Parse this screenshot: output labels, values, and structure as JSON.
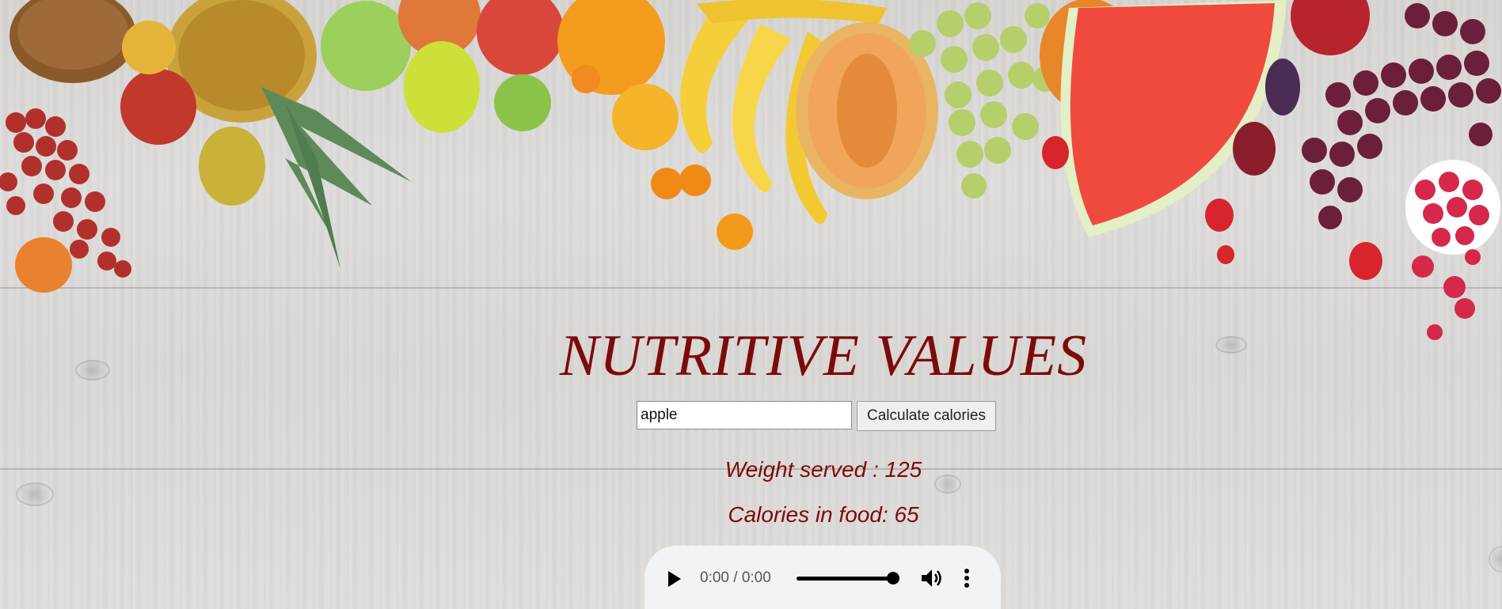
{
  "page": {
    "title": "NUTRITIVE VALUES"
  },
  "search": {
    "value": "apple",
    "button_label": "Calculate calories"
  },
  "results": {
    "weight_text": "Weight served : 125",
    "calories_text": "Calories in food: 65"
  },
  "audio": {
    "time": "0:00 / 0:00",
    "play_icon": "play-icon",
    "volume_icon": "volume-icon",
    "more_icon": "more-options-icon"
  },
  "colors": {
    "title": "#7d0a0a",
    "background": "#d9d8d5"
  }
}
